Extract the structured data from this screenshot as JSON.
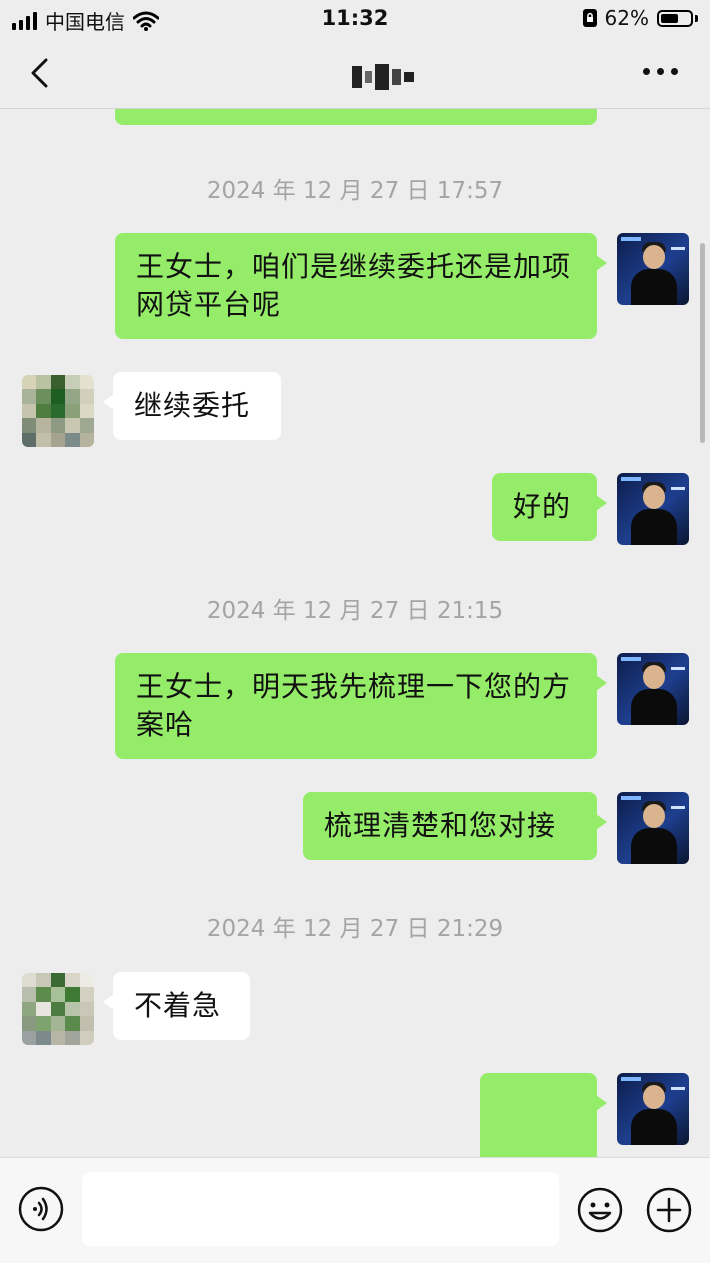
{
  "status_bar": {
    "carrier": "中国电信",
    "time": "11:32",
    "battery_percent": "62%",
    "battery_level": 0.62,
    "icons": [
      "signal-icon",
      "wifi-icon",
      "portrait-lock-icon",
      "battery-icon"
    ]
  },
  "nav": {
    "back_icon": "chevron-left-icon",
    "more_icon": "more-dots-icon"
  },
  "messages": [
    {
      "type": "timestamp",
      "text": "2024 年 12 月 27 日 17:57"
    },
    {
      "type": "message",
      "side": "right",
      "text": "王女士，咱们是继续委托还是加项网贷平台呢"
    },
    {
      "type": "message",
      "side": "left",
      "text": "继续委托"
    },
    {
      "type": "message",
      "side": "right",
      "text": "好的"
    },
    {
      "type": "timestamp",
      "text": "2024 年 12 月 27 日 21:15"
    },
    {
      "type": "message",
      "side": "right",
      "text": "王女士，明天我先梳理一下您的方案哈"
    },
    {
      "type": "message",
      "side": "right",
      "text": "梳理清楚和您对接"
    },
    {
      "type": "timestamp",
      "text": "2024 年 12 月 27 日 21:29"
    },
    {
      "type": "message",
      "side": "left",
      "text": "不着急"
    },
    {
      "type": "message",
      "side": "right",
      "text": "🙏🙏",
      "icon": "praying-hands-emoji"
    }
  ],
  "input_bar": {
    "voice_icon": "voice-input-icon",
    "emoji_icon": "emoji-icon",
    "plus_icon": "plus-icon",
    "text_value": ""
  },
  "colors": {
    "sent_bubble": "#95ec69",
    "received_bubble": "#ffffff",
    "background": "#ededed",
    "timestamp": "#a4a4a4"
  }
}
